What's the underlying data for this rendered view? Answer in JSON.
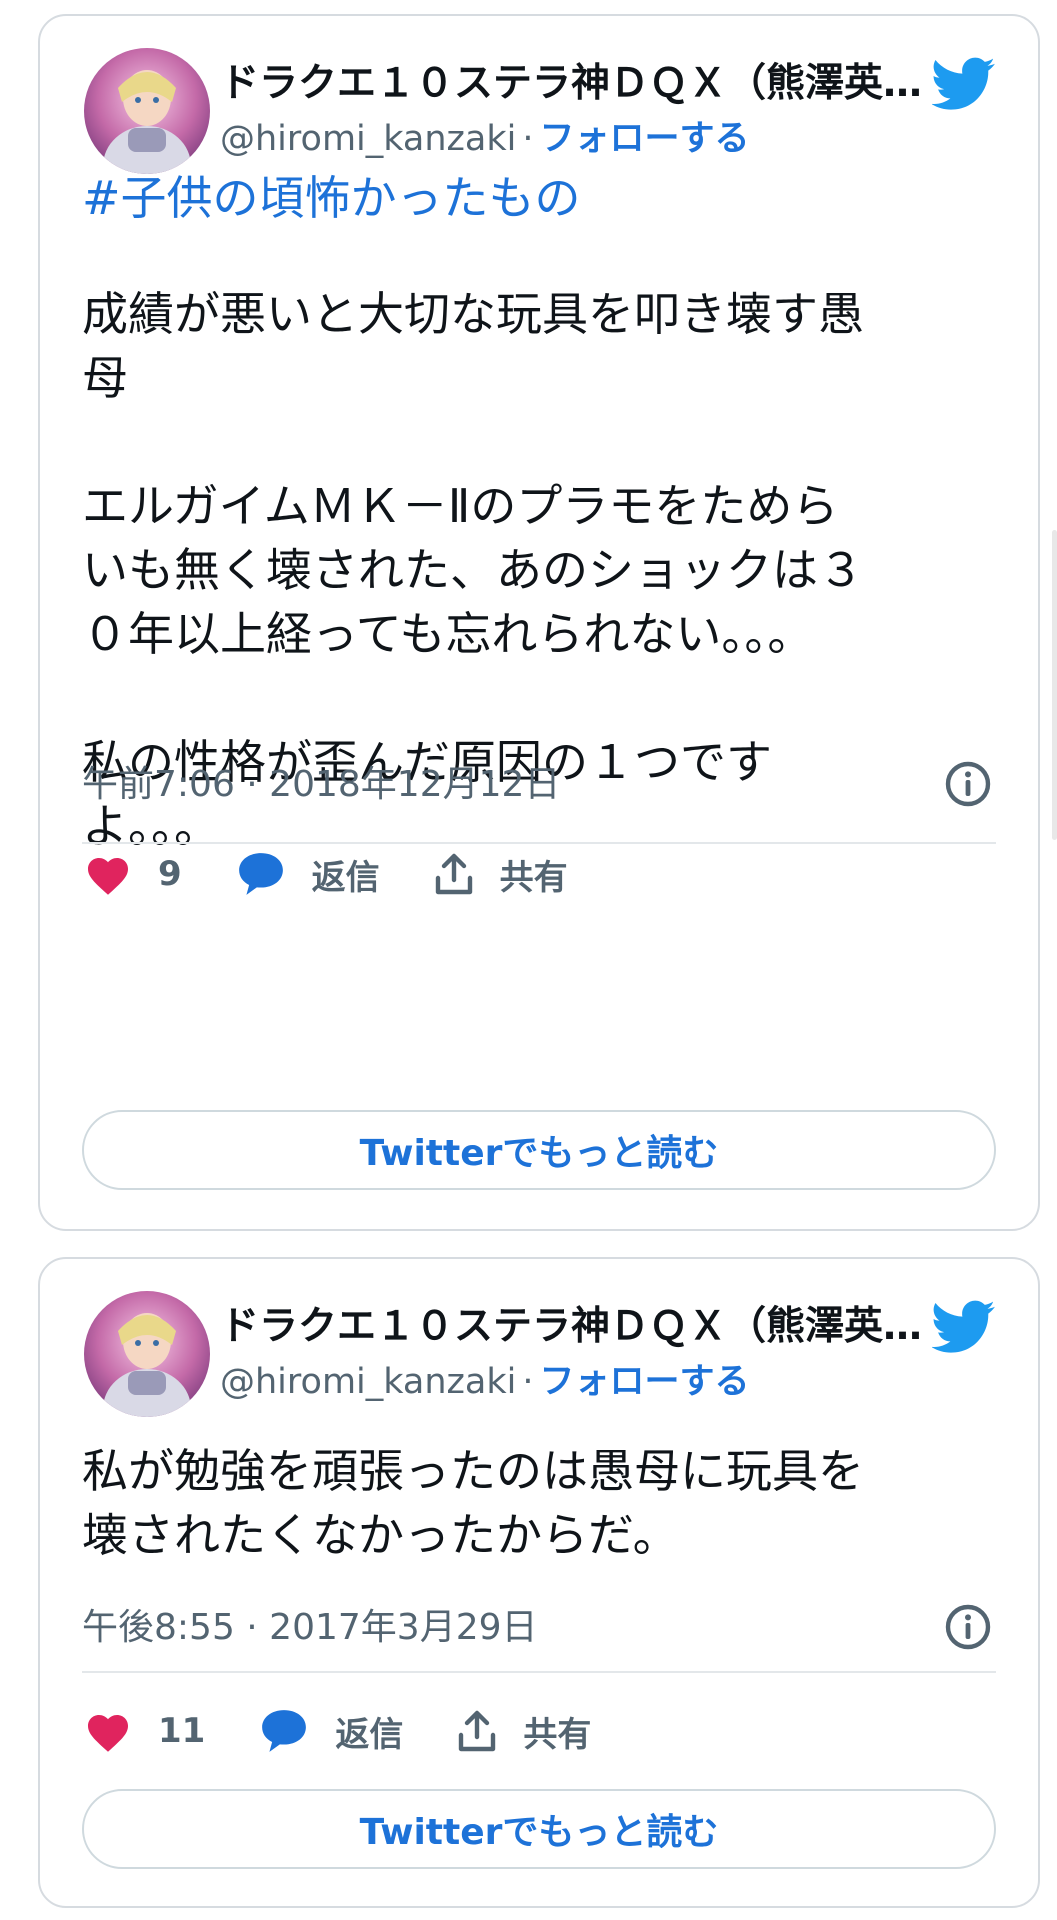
{
  "tweets": [
    {
      "author_name": "ドラクエ１０ステラ神ＤＱＸ（熊澤英…",
      "handle": "@hiromi_kanzaki",
      "separator": "·",
      "follow_label": "フォローする",
      "hashtag": "#子供の頃怖かったもの",
      "text": "成績が悪いと大切な玩具を叩き壊す愚\n母\n\nエルガイムＭＫ－Ⅱのプラモをためら\nいも無く壊された、あのショックは３\n０年以上経っても忘れられない。。。\n\n私の性格が歪んだ原因の１つです\nよ。。。",
      "timestamp": "午前7:06 · 2018年12月12日",
      "like_count": "9",
      "reply_label": "返信",
      "share_label": "共有",
      "more_label": "Twitterでもっと読む"
    },
    {
      "author_name": "ドラクエ１０ステラ神ＤＱＸ（熊澤英…",
      "handle": "@hiromi_kanzaki",
      "separator": "·",
      "follow_label": "フォローする",
      "text": "私が勉強を頑張ったのは愚母に玩具を\n壊されたくなかったからだ。",
      "timestamp": "午後8:55 · 2017年3月29日",
      "like_count": "11",
      "reply_label": "返信",
      "share_label": "共有",
      "more_label": "Twitterでもっと読む"
    }
  ],
  "colors": {
    "accent": "#1d72d8",
    "heart": "#e0245e",
    "twitter_blue": "#1d9bf0",
    "muted": "#536471",
    "border": "#d6dbe0"
  },
  "icons": [
    "avatar",
    "twitter-bird-icon",
    "info-icon",
    "heart-icon",
    "reply-bubble-icon",
    "share-icon"
  ]
}
